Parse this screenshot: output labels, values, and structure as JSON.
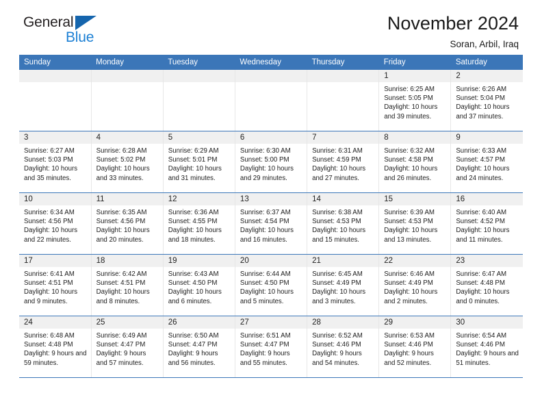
{
  "brand": {
    "line1": "General",
    "line2": "Blue",
    "triangle_color": "#1565ad",
    "blue_color": "#1b7fd4"
  },
  "header": {
    "title": "November 2024",
    "subtitle": "Soran, Arbil, Iraq",
    "accent_color": "#3b76b8"
  },
  "calendar": {
    "weekdays": [
      "Sunday",
      "Monday",
      "Tuesday",
      "Wednesday",
      "Thursday",
      "Friday",
      "Saturday"
    ],
    "weeks": [
      [
        {
          "day": "",
          "sunrise": "",
          "sunset": "",
          "daylight": ""
        },
        {
          "day": "",
          "sunrise": "",
          "sunset": "",
          "daylight": ""
        },
        {
          "day": "",
          "sunrise": "",
          "sunset": "",
          "daylight": ""
        },
        {
          "day": "",
          "sunrise": "",
          "sunset": "",
          "daylight": ""
        },
        {
          "day": "",
          "sunrise": "",
          "sunset": "",
          "daylight": ""
        },
        {
          "day": "1",
          "sunrise": "Sunrise: 6:25 AM",
          "sunset": "Sunset: 5:05 PM",
          "daylight": "Daylight: 10 hours and 39 minutes."
        },
        {
          "day": "2",
          "sunrise": "Sunrise: 6:26 AM",
          "sunset": "Sunset: 5:04 PM",
          "daylight": "Daylight: 10 hours and 37 minutes."
        }
      ],
      [
        {
          "day": "3",
          "sunrise": "Sunrise: 6:27 AM",
          "sunset": "Sunset: 5:03 PM",
          "daylight": "Daylight: 10 hours and 35 minutes."
        },
        {
          "day": "4",
          "sunrise": "Sunrise: 6:28 AM",
          "sunset": "Sunset: 5:02 PM",
          "daylight": "Daylight: 10 hours and 33 minutes."
        },
        {
          "day": "5",
          "sunrise": "Sunrise: 6:29 AM",
          "sunset": "Sunset: 5:01 PM",
          "daylight": "Daylight: 10 hours and 31 minutes."
        },
        {
          "day": "6",
          "sunrise": "Sunrise: 6:30 AM",
          "sunset": "Sunset: 5:00 PM",
          "daylight": "Daylight: 10 hours and 29 minutes."
        },
        {
          "day": "7",
          "sunrise": "Sunrise: 6:31 AM",
          "sunset": "Sunset: 4:59 PM",
          "daylight": "Daylight: 10 hours and 27 minutes."
        },
        {
          "day": "8",
          "sunrise": "Sunrise: 6:32 AM",
          "sunset": "Sunset: 4:58 PM",
          "daylight": "Daylight: 10 hours and 26 minutes."
        },
        {
          "day": "9",
          "sunrise": "Sunrise: 6:33 AM",
          "sunset": "Sunset: 4:57 PM",
          "daylight": "Daylight: 10 hours and 24 minutes."
        }
      ],
      [
        {
          "day": "10",
          "sunrise": "Sunrise: 6:34 AM",
          "sunset": "Sunset: 4:56 PM",
          "daylight": "Daylight: 10 hours and 22 minutes."
        },
        {
          "day": "11",
          "sunrise": "Sunrise: 6:35 AM",
          "sunset": "Sunset: 4:56 PM",
          "daylight": "Daylight: 10 hours and 20 minutes."
        },
        {
          "day": "12",
          "sunrise": "Sunrise: 6:36 AM",
          "sunset": "Sunset: 4:55 PM",
          "daylight": "Daylight: 10 hours and 18 minutes."
        },
        {
          "day": "13",
          "sunrise": "Sunrise: 6:37 AM",
          "sunset": "Sunset: 4:54 PM",
          "daylight": "Daylight: 10 hours and 16 minutes."
        },
        {
          "day": "14",
          "sunrise": "Sunrise: 6:38 AM",
          "sunset": "Sunset: 4:53 PM",
          "daylight": "Daylight: 10 hours and 15 minutes."
        },
        {
          "day": "15",
          "sunrise": "Sunrise: 6:39 AM",
          "sunset": "Sunset: 4:53 PM",
          "daylight": "Daylight: 10 hours and 13 minutes."
        },
        {
          "day": "16",
          "sunrise": "Sunrise: 6:40 AM",
          "sunset": "Sunset: 4:52 PM",
          "daylight": "Daylight: 10 hours and 11 minutes."
        }
      ],
      [
        {
          "day": "17",
          "sunrise": "Sunrise: 6:41 AM",
          "sunset": "Sunset: 4:51 PM",
          "daylight": "Daylight: 10 hours and 9 minutes."
        },
        {
          "day": "18",
          "sunrise": "Sunrise: 6:42 AM",
          "sunset": "Sunset: 4:51 PM",
          "daylight": "Daylight: 10 hours and 8 minutes."
        },
        {
          "day": "19",
          "sunrise": "Sunrise: 6:43 AM",
          "sunset": "Sunset: 4:50 PM",
          "daylight": "Daylight: 10 hours and 6 minutes."
        },
        {
          "day": "20",
          "sunrise": "Sunrise: 6:44 AM",
          "sunset": "Sunset: 4:50 PM",
          "daylight": "Daylight: 10 hours and 5 minutes."
        },
        {
          "day": "21",
          "sunrise": "Sunrise: 6:45 AM",
          "sunset": "Sunset: 4:49 PM",
          "daylight": "Daylight: 10 hours and 3 minutes."
        },
        {
          "day": "22",
          "sunrise": "Sunrise: 6:46 AM",
          "sunset": "Sunset: 4:49 PM",
          "daylight": "Daylight: 10 hours and 2 minutes."
        },
        {
          "day": "23",
          "sunrise": "Sunrise: 6:47 AM",
          "sunset": "Sunset: 4:48 PM",
          "daylight": "Daylight: 10 hours and 0 minutes."
        }
      ],
      [
        {
          "day": "24",
          "sunrise": "Sunrise: 6:48 AM",
          "sunset": "Sunset: 4:48 PM",
          "daylight": "Daylight: 9 hours and 59 minutes."
        },
        {
          "day": "25",
          "sunrise": "Sunrise: 6:49 AM",
          "sunset": "Sunset: 4:47 PM",
          "daylight": "Daylight: 9 hours and 57 minutes."
        },
        {
          "day": "26",
          "sunrise": "Sunrise: 6:50 AM",
          "sunset": "Sunset: 4:47 PM",
          "daylight": "Daylight: 9 hours and 56 minutes."
        },
        {
          "day": "27",
          "sunrise": "Sunrise: 6:51 AM",
          "sunset": "Sunset: 4:47 PM",
          "daylight": "Daylight: 9 hours and 55 minutes."
        },
        {
          "day": "28",
          "sunrise": "Sunrise: 6:52 AM",
          "sunset": "Sunset: 4:46 PM",
          "daylight": "Daylight: 9 hours and 54 minutes."
        },
        {
          "day": "29",
          "sunrise": "Sunrise: 6:53 AM",
          "sunset": "Sunset: 4:46 PM",
          "daylight": "Daylight: 9 hours and 52 minutes."
        },
        {
          "day": "30",
          "sunrise": "Sunrise: 6:54 AM",
          "sunset": "Sunset: 4:46 PM",
          "daylight": "Daylight: 9 hours and 51 minutes."
        }
      ]
    ]
  }
}
